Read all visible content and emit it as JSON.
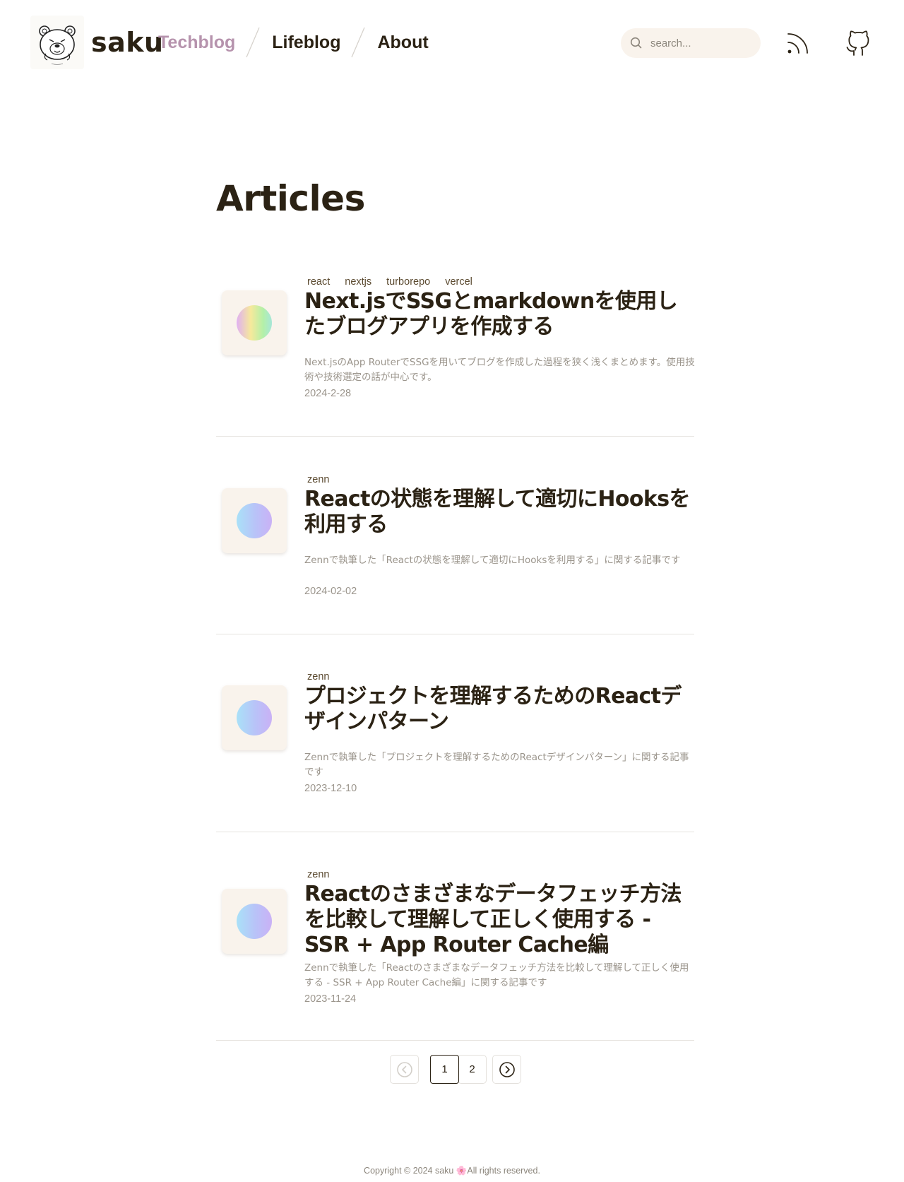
{
  "site": {
    "name": "saku",
    "logo_icon": "bear-logo-icon"
  },
  "nav": {
    "items": [
      {
        "label": "Techblog",
        "active": true
      },
      {
        "label": "Lifeblog",
        "active": false
      },
      {
        "label": "About",
        "active": false
      }
    ]
  },
  "search": {
    "placeholder": "search...",
    "icon": "search-icon"
  },
  "header_icons": {
    "rss": "rss-icon",
    "github": "github-icon"
  },
  "main": {
    "title": "Articles"
  },
  "articles": [
    {
      "tags": [
        "react",
        "nextjs",
        "turborepo",
        "vercel"
      ],
      "title": "Next.jsでSSGとmarkdownを使用したブログアプリを作成する",
      "description": "Next.jsのApp RouterでSSGを用いてブログを作成した過程を狭く浅くまとめます。使用技術や技術選定の話が中心です。",
      "date": "2024-2-28",
      "orb": "rainbow"
    },
    {
      "tags": [
        "zenn"
      ],
      "title": "Reactの状態を理解して適切にHooksを利用する",
      "description": "Zennで執筆した「Reactの状態を理解して適切にHooksを利用する」に関する記事です",
      "date": "2024-02-02",
      "orb": "blue"
    },
    {
      "tags": [
        "zenn"
      ],
      "title": "プロジェクトを理解するためのReactデザインパターン",
      "description": "Zennで執筆した「プロジェクトを理解するためのReactデザインパターン」に関する記事です",
      "date": "2023-12-10",
      "orb": "blue"
    },
    {
      "tags": [
        "zenn"
      ],
      "title": "Reactのさまざまなデータフェッチ方法を比較して理解して正しく使用する - SSR + App Router Cache編",
      "description": "Zennで執筆した「Reactのさまざまなデータフェッチ方法を比較して理解して正しく使用する - SSR + App Router Cache編」に関する記事です",
      "date": "2023-11-24",
      "orb": "blue"
    }
  ],
  "pagination": {
    "pages": [
      "1",
      "2"
    ],
    "current": "1",
    "prev_icon": "chevron-left-circle-icon",
    "next_icon": "chevron-right-circle-icon"
  },
  "footer": {
    "text": "Copyright © 2024 saku 🌸All rights reserved."
  },
  "colors": {
    "text": "#2b2214",
    "accent": "#b693ad",
    "muted": "#9b958c",
    "surface": "#f9f3ec"
  }
}
